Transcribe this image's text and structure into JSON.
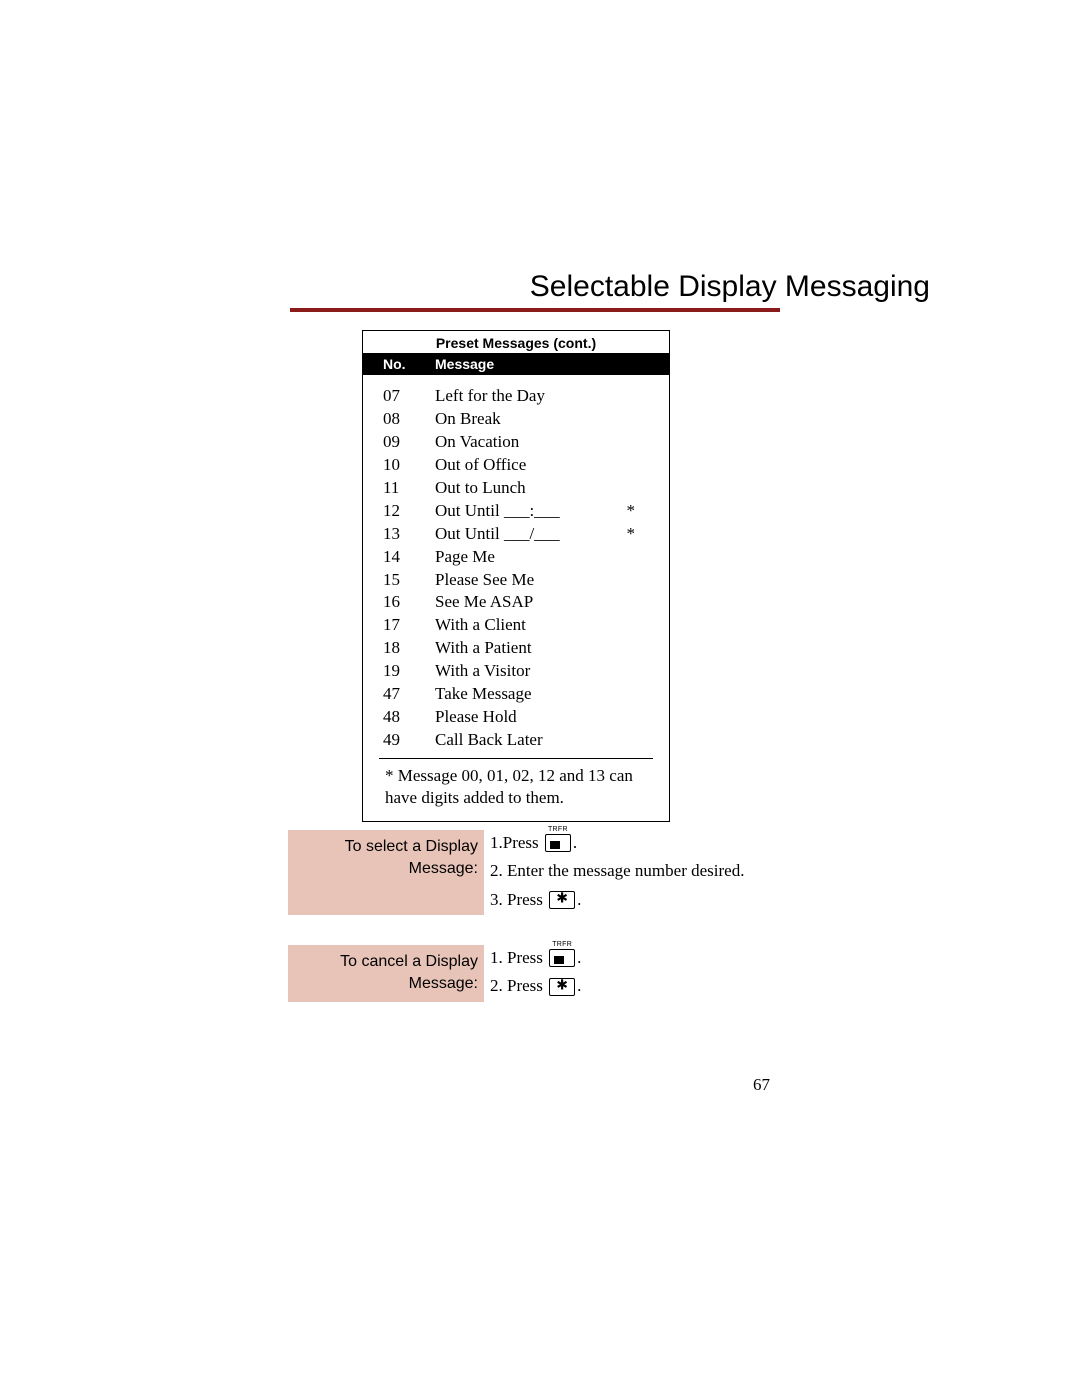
{
  "page": {
    "title": "Selectable Display Messaging",
    "number": "67"
  },
  "table": {
    "title": "Preset Messages (cont.)",
    "headers": {
      "no": "No.",
      "message": "Message"
    },
    "rows": [
      {
        "no": "07",
        "msg": "Left for the Day",
        "star": ""
      },
      {
        "no": "08",
        "msg": "On Break",
        "star": ""
      },
      {
        "no": "09",
        "msg": "On Vacation",
        "star": ""
      },
      {
        "no": "10",
        "msg": "Out of Office",
        "star": ""
      },
      {
        "no": "11",
        "msg": "Out to Lunch",
        "star": ""
      },
      {
        "no": "12",
        "msg": "Out Until ___:___",
        "star": "*"
      },
      {
        "no": "13",
        "msg": "Out Until ___/___",
        "star": "*"
      },
      {
        "no": "14",
        "msg": "Page Me",
        "star": ""
      },
      {
        "no": "15",
        "msg": "Please See Me",
        "star": ""
      },
      {
        "no": "16",
        "msg": "See Me ASAP",
        "star": ""
      },
      {
        "no": "17",
        "msg": "With a Client",
        "star": ""
      },
      {
        "no": "18",
        "msg": "With a Patient",
        "star": ""
      },
      {
        "no": "19",
        "msg": "With a Visitor",
        "star": ""
      },
      {
        "no": "47",
        "msg": "Take Message",
        "star": ""
      },
      {
        "no": "48",
        "msg": "Please Hold",
        "star": ""
      },
      {
        "no": "49",
        "msg": "Call Back Later",
        "star": ""
      }
    ],
    "note": "* Message 00, 01, 02, 12 and 13 can have digits added to them."
  },
  "instructions": {
    "select": {
      "label": "To select a Display Message:",
      "step1_pre": "1.Press ",
      "step1_post": " .",
      "step2": "2. Enter the message number desired.",
      "step3_pre": "3. Press ",
      "step3_post": " ."
    },
    "cancel": {
      "label": "To cancel a Display Message:",
      "step1_pre": "1. Press ",
      "step1_post": " .",
      "step2_pre": "2. Press ",
      "step2_post": " ."
    }
  },
  "keys": {
    "trfr_label": "TRFR"
  }
}
